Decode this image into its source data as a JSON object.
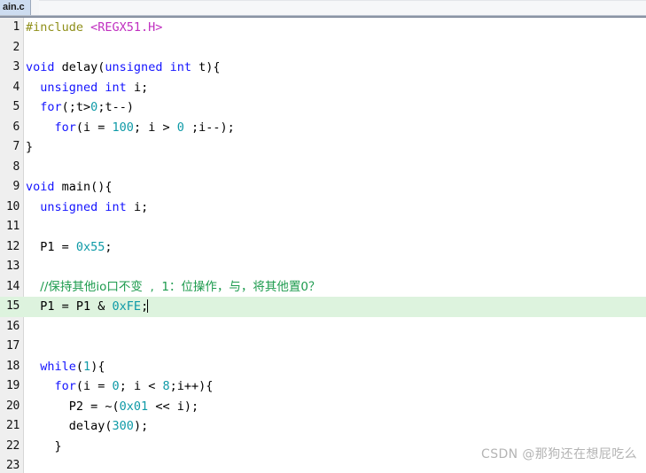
{
  "tabbar": {
    "active_tab_label": "ain.c",
    "active_tab_full_name": "main.c"
  },
  "editor": {
    "cursor_line": 15,
    "highlighted_line": 15,
    "colors": {
      "keyword": "#1414ff",
      "number": "#0e9aa7",
      "preprocessor": "#8f8f18",
      "include_path": "#c030c0",
      "comment": "#1d9b4e",
      "text": "#000000",
      "gutter_background": "#efefef",
      "current_line_background": "#ddf3de",
      "editor_background": "#ffffff",
      "active_tab_background": "#cddcf0"
    },
    "lines": [
      {
        "n": "1",
        "tokens": [
          {
            "t": "#include ",
            "c": "pp"
          },
          {
            "t": "<REGX51.H>",
            "c": "inc"
          }
        ]
      },
      {
        "n": "2",
        "tokens": []
      },
      {
        "n": "3",
        "tokens": [
          {
            "t": "void ",
            "c": "kw"
          },
          {
            "t": "delay(",
            "c": "plain"
          },
          {
            "t": "unsigned int ",
            "c": "kw"
          },
          {
            "t": "t){",
            "c": "plain"
          }
        ]
      },
      {
        "n": "4",
        "tokens": [
          {
            "t": "  ",
            "c": "plain"
          },
          {
            "t": "unsigned int ",
            "c": "kw"
          },
          {
            "t": "i;",
            "c": "plain"
          }
        ]
      },
      {
        "n": "5",
        "tokens": [
          {
            "t": "  ",
            "c": "plain"
          },
          {
            "t": "for",
            "c": "kw"
          },
          {
            "t": "(;t>",
            "c": "plain"
          },
          {
            "t": "0",
            "c": "num"
          },
          {
            "t": ";t--)",
            "c": "plain"
          }
        ]
      },
      {
        "n": "6",
        "tokens": [
          {
            "t": "    ",
            "c": "plain"
          },
          {
            "t": "for",
            "c": "kw"
          },
          {
            "t": "(i = ",
            "c": "plain"
          },
          {
            "t": "100",
            "c": "num"
          },
          {
            "t": "; i > ",
            "c": "plain"
          },
          {
            "t": "0",
            "c": "num"
          },
          {
            "t": " ;i--);",
            "c": "plain"
          }
        ]
      },
      {
        "n": "7",
        "tokens": [
          {
            "t": "}",
            "c": "plain"
          }
        ]
      },
      {
        "n": "8",
        "tokens": []
      },
      {
        "n": "9",
        "tokens": [
          {
            "t": "void ",
            "c": "kw"
          },
          {
            "t": "main(){",
            "c": "plain"
          }
        ]
      },
      {
        "n": "10",
        "tokens": [
          {
            "t": "  ",
            "c": "plain"
          },
          {
            "t": "unsigned int ",
            "c": "kw"
          },
          {
            "t": "i;",
            "c": "plain"
          }
        ]
      },
      {
        "n": "11",
        "tokens": []
      },
      {
        "n": "12",
        "tokens": [
          {
            "t": "  P1 = ",
            "c": "plain"
          },
          {
            "t": "0x55",
            "c": "num"
          },
          {
            "t": ";",
            "c": "plain"
          }
        ]
      },
      {
        "n": "13",
        "tokens": []
      },
      {
        "n": "14",
        "tokens": [
          {
            "t": "  ",
            "c": "plain"
          },
          {
            "t": "//保持其他io口不变  ,  1：位操作，与，将其他置0？",
            "c": "cmt"
          }
        ]
      },
      {
        "n": "15",
        "tokens": [
          {
            "t": "  P1 = P1 & ",
            "c": "plain"
          },
          {
            "t": "0xFE",
            "c": "num"
          },
          {
            "t": ";",
            "c": "plain"
          }
        ],
        "caret": true,
        "highlight": true
      },
      {
        "n": "16",
        "tokens": []
      },
      {
        "n": "17",
        "tokens": []
      },
      {
        "n": "18",
        "tokens": [
          {
            "t": "  ",
            "c": "plain"
          },
          {
            "t": "while",
            "c": "kw"
          },
          {
            "t": "(",
            "c": "plain"
          },
          {
            "t": "1",
            "c": "num"
          },
          {
            "t": "){",
            "c": "plain"
          }
        ]
      },
      {
        "n": "19",
        "tokens": [
          {
            "t": "    ",
            "c": "plain"
          },
          {
            "t": "for",
            "c": "kw"
          },
          {
            "t": "(i = ",
            "c": "plain"
          },
          {
            "t": "0",
            "c": "num"
          },
          {
            "t": "; i < ",
            "c": "plain"
          },
          {
            "t": "8",
            "c": "num"
          },
          {
            "t": ";i++){",
            "c": "plain"
          }
        ]
      },
      {
        "n": "20",
        "tokens": [
          {
            "t": "      P2 = ~(",
            "c": "plain"
          },
          {
            "t": "0x01",
            "c": "num"
          },
          {
            "t": " << i);",
            "c": "plain"
          }
        ]
      },
      {
        "n": "21",
        "tokens": [
          {
            "t": "      delay(",
            "c": "plain"
          },
          {
            "t": "300",
            "c": "num"
          },
          {
            "t": ");",
            "c": "plain"
          }
        ]
      },
      {
        "n": "22",
        "tokens": [
          {
            "t": "    }",
            "c": "plain"
          }
        ]
      },
      {
        "n": "23",
        "tokens": []
      }
    ]
  },
  "watermark": {
    "text": "CSDN @那狗还在想屁吃么"
  }
}
